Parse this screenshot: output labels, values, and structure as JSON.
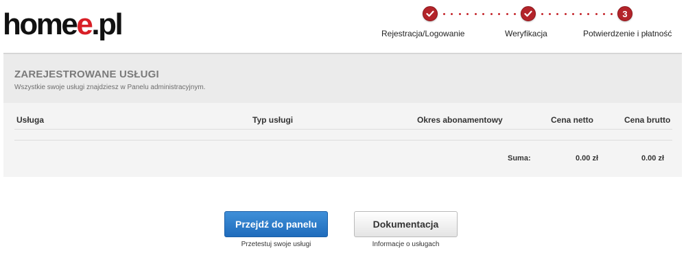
{
  "brand": {
    "logo_part1": "home",
    "logo_part2": "e",
    "logo_part3": ".pl"
  },
  "steps": [
    {
      "label": "Rejestracja/Logowanie",
      "state": "done",
      "icon": "check-icon"
    },
    {
      "label": "Weryfikacja",
      "state": "done",
      "icon": "check-icon"
    },
    {
      "label": "Potwierdzenie i płatność",
      "state": "current",
      "number": "3"
    }
  ],
  "colors": {
    "accent": "#d81f26",
    "step": "#b3242a",
    "primary_button": "#2a7ac9",
    "panel_bg": "#f4f4f4"
  },
  "services": {
    "title": "ZAREJESTROWANE USŁUGI",
    "subtitle": "Wszystkie swoje usługi znajdziesz w Panelu administracyjnym.",
    "columns": [
      "Usługa",
      "Typ usługi",
      "Okres abonamentowy",
      "Cena netto",
      "Cena brutto"
    ],
    "rows": [],
    "summary": {
      "label": "Suma:",
      "net": "0.00 zł",
      "gross": "0.00 zł"
    }
  },
  "actions": {
    "panel_button": "Przejdź do panelu",
    "panel_caption": "Przetestuj swoje usługi",
    "docs_button": "Dokumentacja",
    "docs_caption": "Informacje o usługach"
  }
}
